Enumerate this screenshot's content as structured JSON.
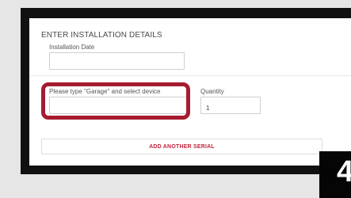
{
  "form": {
    "section_title": "ENTER INSTALLATION DETAILS",
    "installation_date": {
      "label": "Installation Date",
      "value": ""
    },
    "device_search": {
      "label": "Please type \"Garage\" and select device",
      "value": ""
    },
    "quantity": {
      "label": "Quantity",
      "value": "1"
    },
    "add_serial_label": "ADD ANOTHER SERIAL"
  },
  "step_badge": {
    "number": "4"
  },
  "colors": {
    "highlight": "#a51c30",
    "button_text": "#c0263e",
    "frame": "#111111"
  }
}
